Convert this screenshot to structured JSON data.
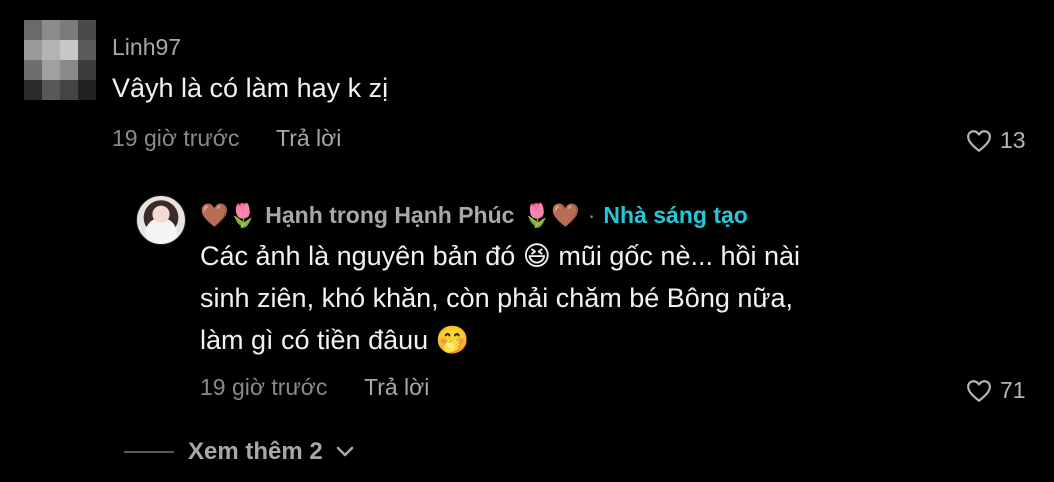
{
  "comments": [
    {
      "username": "Linh97",
      "text": "Vâyh là có làm hay k zị",
      "time": "19 giờ trước",
      "reply_label": "Trả lời",
      "likes": "13"
    }
  ],
  "reply": {
    "name_prefix_emoji": "🤎🌷",
    "name": "Hạnh trong Hạnh Phúc",
    "name_suffix_emoji": "🌷🤎",
    "separator": "·",
    "creator_badge": "Nhà sáng tạo",
    "line1": "Các ảnh là nguyên bản đó 😆 mũi gốc nè... hồi nài",
    "line2": "sinh ziên, khó khăn, còn phải chăm bé Bông nữa,",
    "line3": "làm gì có tiền đâuu 🤭",
    "time": "19 giờ trước",
    "reply_label": "Trả lời",
    "likes": "71"
  },
  "view_more_label": "Xem thêm 2",
  "colors": {
    "background": "#000000",
    "text": "#f2f2f2",
    "muted": "#8a8a8a",
    "creator": "#25c7d8"
  },
  "icons": {
    "like": "heart-outline-icon",
    "expand": "chevron-down-icon"
  }
}
